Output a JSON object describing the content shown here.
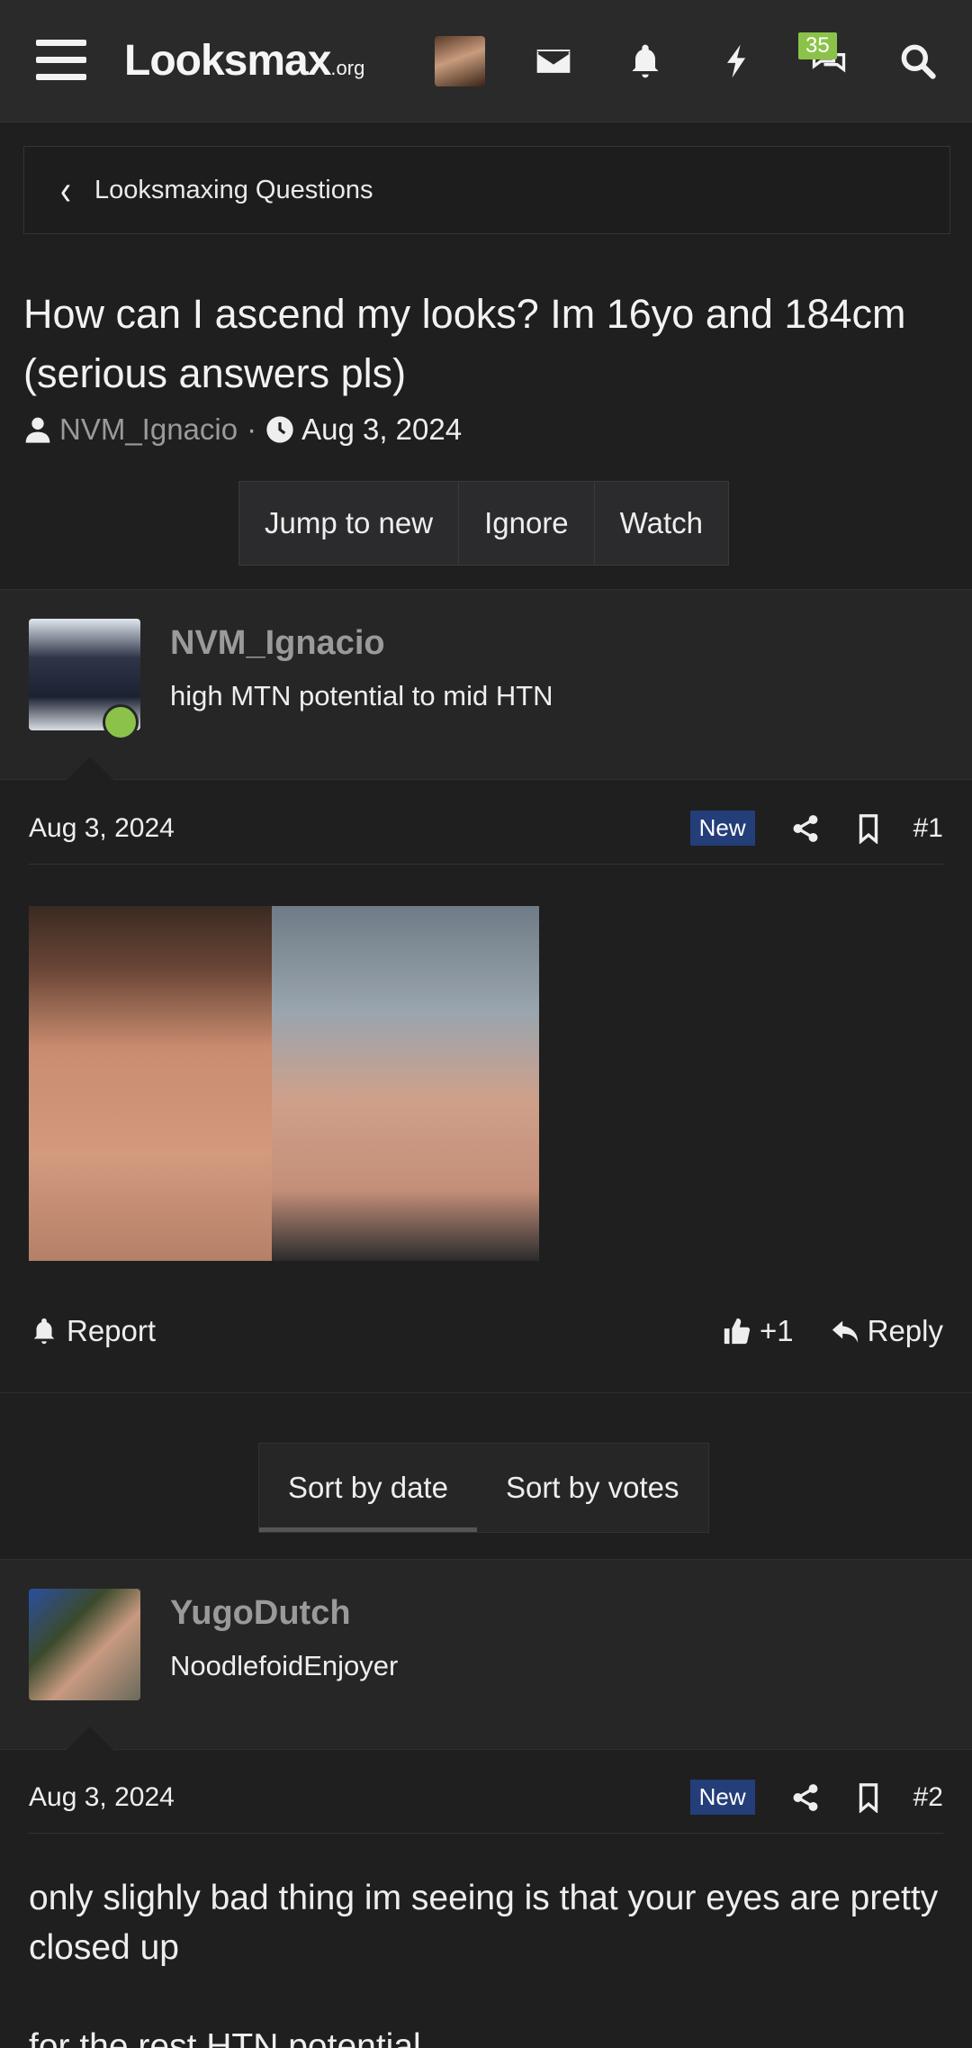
{
  "nav": {
    "logo": "Looksmax",
    "logo_suffix": ".org",
    "chat_badge": "35",
    "icons": [
      "menu-icon",
      "mail-icon",
      "bell-icon",
      "bolt-icon",
      "chat-icon",
      "search-icon"
    ]
  },
  "breadcrumb": {
    "label": "Looksmaxing Questions"
  },
  "thread": {
    "title": "How can I ascend my looks? Im 16yo and 184cm (serious answers pls)",
    "author": "NVM_Ignacio",
    "date": "Aug 3, 2024",
    "separator": "·"
  },
  "actions": {
    "jump": "Jump to new",
    "ignore": "Ignore",
    "watch": "Watch"
  },
  "posts": [
    {
      "username": "NVM_Ignacio",
      "user_title": "high MTN potential to mid HTN",
      "date": "Aug 3, 2024",
      "badge": "New",
      "number": "#1",
      "report": "Report",
      "likes": "+1",
      "reply": "Reply"
    },
    {
      "username": "YugoDutch",
      "user_title": "NoodlefoidEnjoyer",
      "date": "Aug 3, 2024",
      "badge": "New",
      "number": "#2",
      "body_1": "only slighly bad thing im seeing is that your eyes are pretty closed up",
      "body_2": "for the rest HTN potential"
    }
  ],
  "sort": {
    "by_date": "Sort by date",
    "by_votes": "Sort by votes"
  },
  "colors": {
    "accent_green": "#8bc34a",
    "new_badge": "#233e78",
    "background": "#1f1f20"
  }
}
